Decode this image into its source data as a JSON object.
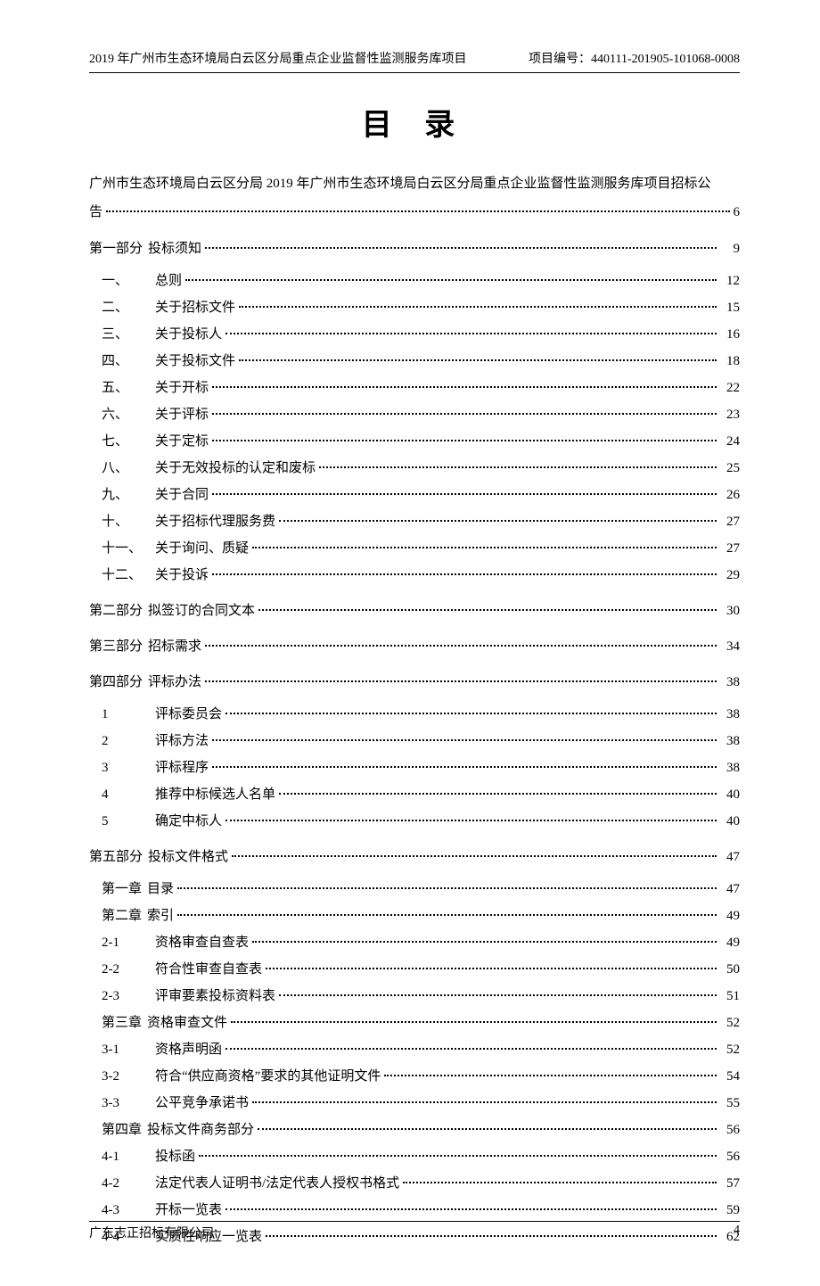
{
  "header": {
    "left": "2019 年广州市生态环境局白云区分局重点企业监督性监测服务库项目",
    "right": "项目编号：440111-201905-101068-0008"
  },
  "title": "目  录",
  "announcement": {
    "line1": "广州市生态环境局白云区分局 2019 年广州市生态环境局白云区分局重点企业监督性监测服务库项目招标公",
    "line2_label": "告",
    "line2_page": "6"
  },
  "parts": [
    {
      "header_num": "第一部分",
      "header_label": "投标须知",
      "header_page": "9",
      "items": [
        {
          "num": "一、",
          "label": "总则",
          "page": "12"
        },
        {
          "num": "二、",
          "label": "关于招标文件",
          "page": "15"
        },
        {
          "num": "三、",
          "label": "关于投标人",
          "page": "16"
        },
        {
          "num": "四、",
          "label": "关于投标文件",
          "page": "18"
        },
        {
          "num": "五、",
          "label": "关于开标",
          "page": "22"
        },
        {
          "num": "六、",
          "label": "关于评标",
          "page": "23"
        },
        {
          "num": "七、",
          "label": "关于定标",
          "page": "24"
        },
        {
          "num": "八、",
          "label": "关于无效投标的认定和废标",
          "page": "25"
        },
        {
          "num": "九、",
          "label": "关于合同",
          "page": "26"
        },
        {
          "num": "十、",
          "label": "关于招标代理服务费",
          "page": "27"
        },
        {
          "num": "十一、",
          "label": "关于询问、质疑",
          "page": "27"
        },
        {
          "num": "十二、",
          "label": "关于投诉",
          "page": "29"
        }
      ]
    },
    {
      "header_num": "第二部分",
      "header_label": "拟签订的合同文本",
      "header_page": "30",
      "items": []
    },
    {
      "header_num": "第三部分",
      "header_label": "招标需求",
      "header_page": "34",
      "items": []
    },
    {
      "header_num": "第四部分",
      "header_label": "评标办法",
      "header_page": "38",
      "items": [
        {
          "num": "1",
          "label": "评标委员会",
          "page": "38"
        },
        {
          "num": "2",
          "label": "评标方法",
          "page": "38"
        },
        {
          "num": "3",
          "label": "评标程序",
          "page": "38"
        },
        {
          "num": "4",
          "label": "推荐中标候选人名单",
          "page": "40"
        },
        {
          "num": "5",
          "label": "确定中标人",
          "page": "40"
        }
      ]
    },
    {
      "header_num": "第五部分",
      "header_label": "投标文件格式",
      "header_page": "47",
      "items": [
        {
          "num": "第一章",
          "label": "目录",
          "page": "47",
          "chapter": true
        },
        {
          "num": "第二章",
          "label": "索引",
          "page": "49",
          "chapter": true
        },
        {
          "num": "2-1",
          "label": "资格审查自查表",
          "page": "49"
        },
        {
          "num": "2-2",
          "label": "符合性审查自查表",
          "page": "50"
        },
        {
          "num": "2-3",
          "label": "评审要素投标资料表",
          "page": "51"
        },
        {
          "num": "第三章",
          "label": "资格审查文件",
          "page": "52",
          "chapter": true
        },
        {
          "num": "3-1",
          "label": "资格声明函",
          "page": "52"
        },
        {
          "num": "3-2",
          "label": "符合“供应商资格”要求的其他证明文件",
          "page": "54"
        },
        {
          "num": "3-3",
          "label": "公平竞争承诺书",
          "page": "55"
        },
        {
          "num": "第四章",
          "label": "投标文件商务部分",
          "page": "56",
          "chapter": true
        },
        {
          "num": "4-1",
          "label": "投标函",
          "page": "56"
        },
        {
          "num": "4-2",
          "label": "法定代表人证明书/法定代表人授权书格式",
          "page": "57"
        },
        {
          "num": "4-3",
          "label": "开标一览表",
          "page": "59"
        },
        {
          "num": "4-4",
          "label": "实质性响应一览表",
          "page": "62"
        }
      ]
    }
  ],
  "footer": {
    "left": "广东志正招标有限公司",
    "page": "4"
  }
}
